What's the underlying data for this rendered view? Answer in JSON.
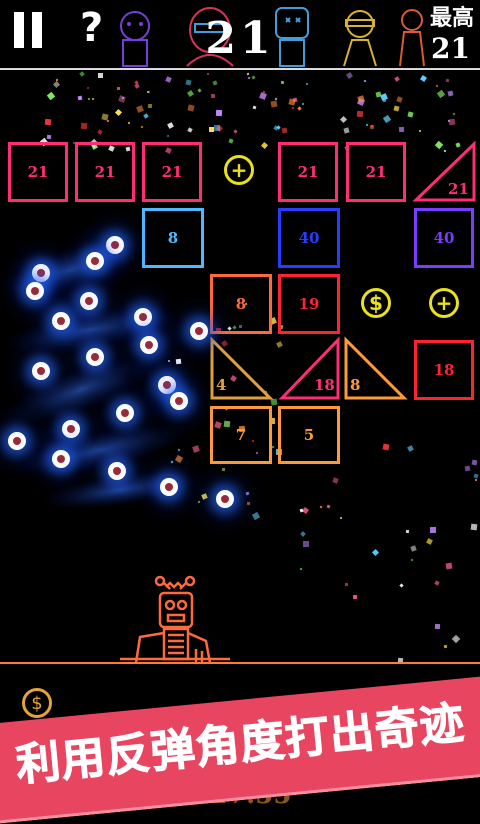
{
  "header": {
    "help_label": "?",
    "score": "21",
    "best_label": "最高",
    "best_value": "21"
  },
  "colors": {
    "pink": "#ff2d78",
    "red": "#ff2233",
    "orange": "#ff6a3d",
    "amber": "#ff9a3a",
    "tan": "#e0a040",
    "sky": "#4fb8ff",
    "blue": "#2a3cff",
    "violet": "#7a3cff",
    "yellow": "#e8e020",
    "banner": "#e84560"
  },
  "bricks": [
    {
      "row": 1,
      "col": 1,
      "value": "21",
      "color": "pink"
    },
    {
      "row": 1,
      "col": 2,
      "value": "21",
      "color": "pink"
    },
    {
      "row": 1,
      "col": 3,
      "value": "21",
      "color": "pink"
    },
    {
      "row": 1,
      "col": 5,
      "value": "21",
      "color": "pink"
    },
    {
      "row": 1,
      "col": 6,
      "value": "21",
      "color": "pink"
    },
    {
      "row": 2,
      "col": 3,
      "value": "8",
      "color": "sky"
    },
    {
      "row": 2,
      "col": 5,
      "value": "40",
      "color": "blue"
    },
    {
      "row": 2,
      "col": 7,
      "value": "40",
      "color": "violet"
    },
    {
      "row": 3,
      "col": 4,
      "value": "8",
      "color": "orange"
    },
    {
      "row": 3,
      "col": 5,
      "value": "19",
      "color": "red"
    },
    {
      "row": 4,
      "col": 7,
      "value": "18",
      "color": "red"
    },
    {
      "row": 5,
      "col": 4,
      "value": "7",
      "color": "amber"
    },
    {
      "row": 5,
      "col": 5,
      "value": "5",
      "color": "amber"
    }
  ],
  "triangles": [
    {
      "label": "21",
      "color": "pink"
    },
    {
      "label": "4",
      "color": "tan"
    },
    {
      "label": "18",
      "color": "pink"
    },
    {
      "label": "8",
      "color": "amber"
    }
  ],
  "pickups": [
    {
      "type": "plus",
      "symbol": "+",
      "color": "yellow"
    },
    {
      "type": "coin",
      "symbol": "$",
      "color": "yellow"
    },
    {
      "type": "plus",
      "symbol": "+",
      "color": "yellow"
    }
  ],
  "banner": {
    "text": "利用反弹角度打出奇迹"
  },
  "bottom_coin_symbol": "$",
  "bottom_ghost_text": "17.55"
}
